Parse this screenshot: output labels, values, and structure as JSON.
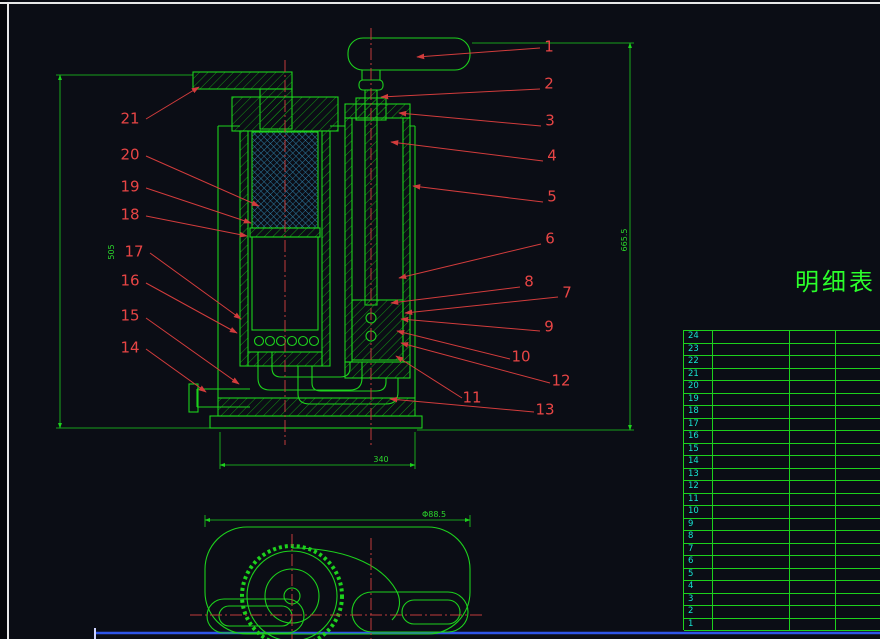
{
  "title": {
    "parts_list": "明细表"
  },
  "callouts": [
    "1",
    "2",
    "3",
    "4",
    "5",
    "6",
    "7",
    "8",
    "9",
    "10",
    "11",
    "12",
    "13",
    "14",
    "15",
    "16",
    "17",
    "18",
    "19",
    "20",
    "21"
  ],
  "table": {
    "rows": [
      "24",
      "23",
      "22",
      "21",
      "20",
      "19",
      "18",
      "17",
      "16",
      "15",
      "14",
      "13",
      "12",
      "11",
      "10",
      "9",
      "8",
      "7",
      "6",
      "5",
      "4",
      "3",
      "2",
      "1"
    ]
  },
  "dims": {
    "left_height": "505",
    "right_height": "665.5",
    "bottom_width": "340",
    "bottom_view_width": "Φ88.5"
  },
  "colors": {
    "background": "#0b0d15",
    "geometry_green": "#1dd11d",
    "annotation_red": "#e84545",
    "centerline_red": "#c23b3b",
    "table_text_cyan": "#17e2d0",
    "title_green": "#2bff2b",
    "frame_blue": "#2e55e8",
    "sheet_white": "#e8e8e8"
  }
}
